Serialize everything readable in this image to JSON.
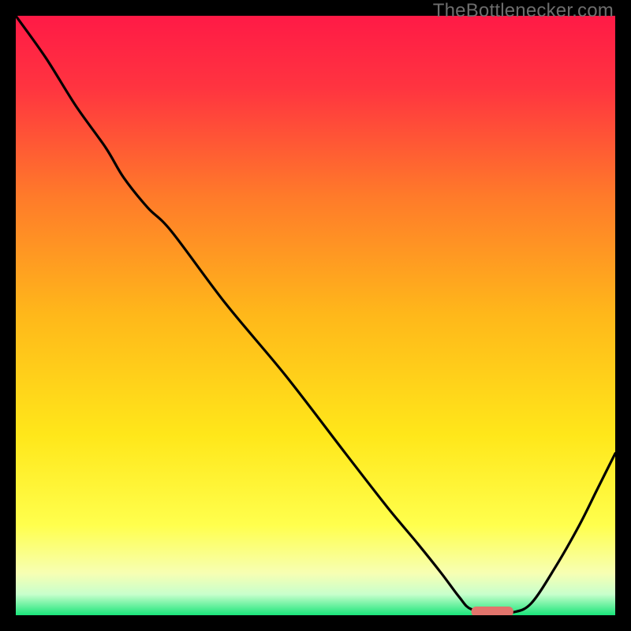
{
  "watermark": "TheBottlenecker.com",
  "chart_data": {
    "type": "line",
    "title": "",
    "xlabel": "",
    "ylabel": "",
    "xlim": [
      0,
      100
    ],
    "ylim": [
      0,
      100
    ],
    "grid": false,
    "legend": false,
    "background_gradient": {
      "stops": [
        {
          "offset": 0.0,
          "color": "#ff1a46"
        },
        {
          "offset": 0.12,
          "color": "#ff3440"
        },
        {
          "offset": 0.3,
          "color": "#ff7a2a"
        },
        {
          "offset": 0.5,
          "color": "#ffb81a"
        },
        {
          "offset": 0.7,
          "color": "#ffe71a"
        },
        {
          "offset": 0.85,
          "color": "#ffff4d"
        },
        {
          "offset": 0.93,
          "color": "#f7ffb3"
        },
        {
          "offset": 0.965,
          "color": "#c8ffcc"
        },
        {
          "offset": 1.0,
          "color": "#19e57a"
        }
      ]
    },
    "curve": {
      "x": [
        0,
        5,
        10,
        15,
        18,
        22,
        26,
        35,
        45,
        55,
        62,
        67,
        71,
        74,
        76,
        80,
        83,
        86,
        90,
        94,
        97,
        100
      ],
      "y": [
        100,
        93,
        85,
        78,
        73,
        68,
        64,
        52,
        40,
        27,
        18,
        12,
        7,
        3,
        1,
        0.5,
        0.5,
        2,
        8,
        15,
        21,
        27
      ]
    },
    "marker": {
      "x_start": 76,
      "x_end": 83,
      "y": 0.6,
      "color": "#e2746c"
    }
  }
}
